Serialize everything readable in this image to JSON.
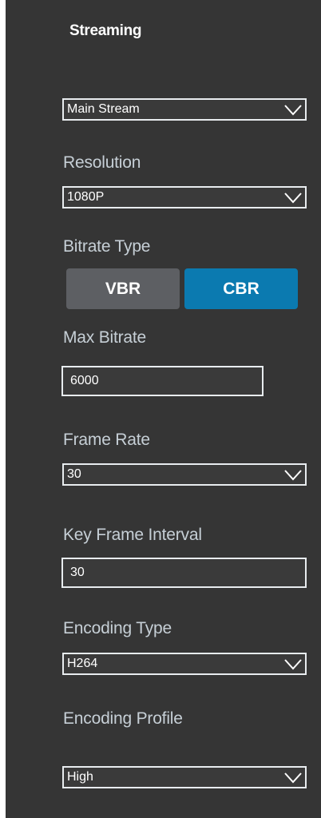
{
  "panel": {
    "title": "Streaming"
  },
  "stream_select": {
    "value": "Main Stream"
  },
  "resolution": {
    "label": "Resolution",
    "value": "1080P"
  },
  "bitrate_type": {
    "label": "Bitrate Type",
    "options": [
      "VBR",
      "CBR"
    ],
    "selected": "CBR"
  },
  "max_bitrate": {
    "label": "Max Bitrate",
    "value": "6000"
  },
  "frame_rate": {
    "label": "Frame Rate",
    "value": "30"
  },
  "key_frame_interval": {
    "label": "Key Frame Interval",
    "value": "30"
  },
  "encoding_type": {
    "label": "Encoding Type",
    "value": "H264"
  },
  "encoding_profile": {
    "label": "Encoding Profile",
    "value": "High"
  },
  "colors": {
    "panel_bg": "#353535",
    "label_text": "#c6cfd6",
    "selected_accent": "#0b7ab0",
    "unselected_button": "#5d5f63",
    "field_border": "#e8ecef"
  },
  "icons": {
    "dropdown": "chevron-down-icon"
  }
}
